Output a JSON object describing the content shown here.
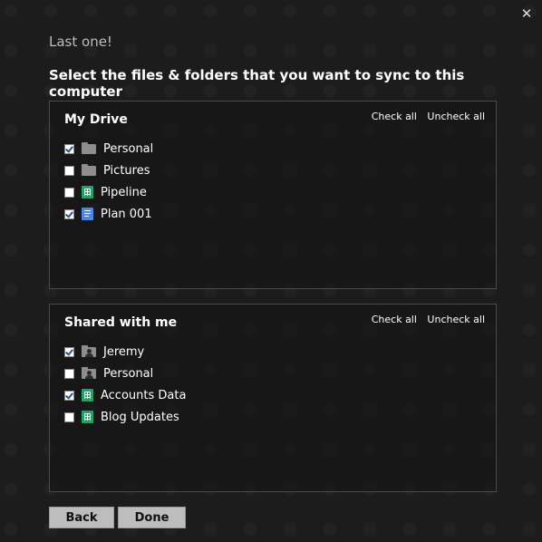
{
  "dialog": {
    "step_label": "Last one!",
    "heading": "Select the files & folders that you want to sync to this computer",
    "close_icon": "✕"
  },
  "my_drive": {
    "title": "My Drive",
    "check_all": "Check all",
    "uncheck_all": "Uncheck all",
    "items": [
      {
        "label": "Personal",
        "checked": true,
        "icon": "folder-icon"
      },
      {
        "label": "Pictures",
        "checked": false,
        "icon": "folder-icon"
      },
      {
        "label": "Pipeline",
        "checked": false,
        "icon": "spreadsheet-icon"
      },
      {
        "label": "Plan 001",
        "checked": true,
        "icon": "document-icon"
      }
    ]
  },
  "shared": {
    "title": "Shared with me",
    "check_all": "Check all",
    "uncheck_all": "Uncheck all",
    "items": [
      {
        "label": "Jeremy",
        "checked": true,
        "icon": "shared-folder-icon"
      },
      {
        "label": "Personal",
        "checked": false,
        "icon": "shared-folder-icon"
      },
      {
        "label": "Accounts Data",
        "checked": true,
        "icon": "spreadsheet-icon"
      },
      {
        "label": "Blog Updates",
        "checked": false,
        "icon": "spreadsheet-icon"
      }
    ]
  },
  "buttons": {
    "back": "Back",
    "done": "Done"
  },
  "colors": {
    "background": "#1c1c1c",
    "sheet_green": "#1fa463",
    "doc_blue": "#4a86e8",
    "button_gray": "#bdbdbd"
  }
}
